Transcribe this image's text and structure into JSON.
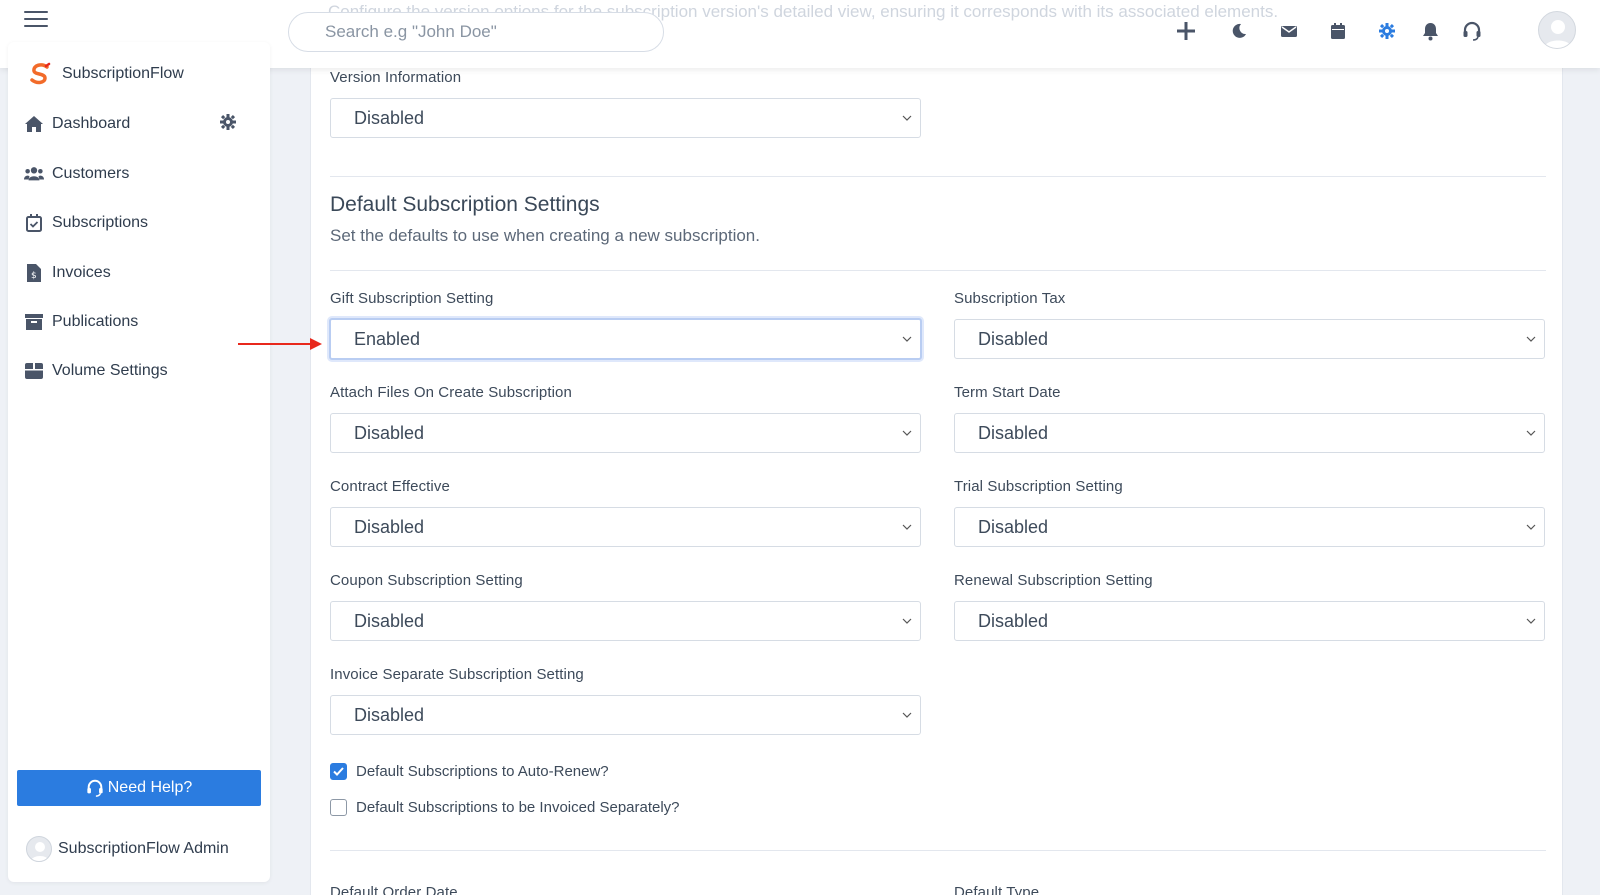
{
  "topbar": {
    "ghost_text": "Configure the version options for the subscription version's detailed view, ensuring it corresponds with its associated elements.",
    "search_placeholder": "Search e.g \"John Doe\"",
    "icons": [
      "plus-icon",
      "moon-icon",
      "mail-icon",
      "calendar-icon",
      "gear-icon",
      "bell-icon",
      "headset-icon",
      "avatar"
    ],
    "active_icon_color": "#2b7ce0"
  },
  "sidebar": {
    "brand": "SubscriptionFlow",
    "items": [
      {
        "label": "Dashboard",
        "icon": "home-icon"
      },
      {
        "label": "Customers",
        "icon": "users-icon"
      },
      {
        "label": "Subscriptions",
        "icon": "calendar-check-icon"
      },
      {
        "label": "Invoices",
        "icon": "invoice-icon"
      },
      {
        "label": "Publications",
        "icon": "archive-icon"
      },
      {
        "label": "Volume Settings",
        "icon": "box-icon"
      }
    ],
    "help_button": "Need Help?",
    "admin_name": "SubscriptionFlow Admin"
  },
  "form": {
    "version_information": {
      "label": "Version Information",
      "value": "Disabled"
    },
    "section_title": "Default Subscription Settings",
    "section_subtitle": "Set the defaults to use when creating a new subscription.",
    "fields": {
      "gift": {
        "label": "Gift Subscription Setting",
        "value": "Enabled"
      },
      "tax": {
        "label": "Subscription Tax",
        "value": "Disabled"
      },
      "attach": {
        "label": "Attach Files On Create Subscription",
        "value": "Disabled"
      },
      "term_start": {
        "label": "Term Start Date",
        "value": "Disabled"
      },
      "contract": {
        "label": "Contract Effective",
        "value": "Disabled"
      },
      "trial": {
        "label": "Trial Subscription Setting",
        "value": "Disabled"
      },
      "coupon": {
        "label": "Coupon Subscription Setting",
        "value": "Disabled"
      },
      "renewal": {
        "label": "Renewal Subscription Setting",
        "value": "Disabled"
      },
      "invoice_separate": {
        "label": "Invoice Separate Subscription Setting",
        "value": "Disabled"
      }
    },
    "checkboxes": {
      "auto_renew": {
        "label": "Default Subscriptions to Auto-Renew?",
        "checked": true
      },
      "invoiced_separately": {
        "label": "Default Subscriptions to be Invoiced Separately?",
        "checked": false
      }
    },
    "bottom_labels": {
      "order_date": "Default Order Date",
      "type": "Default Type"
    }
  },
  "colors": {
    "accent": "#2b7ce0",
    "annotation_arrow": "#e8281c"
  }
}
